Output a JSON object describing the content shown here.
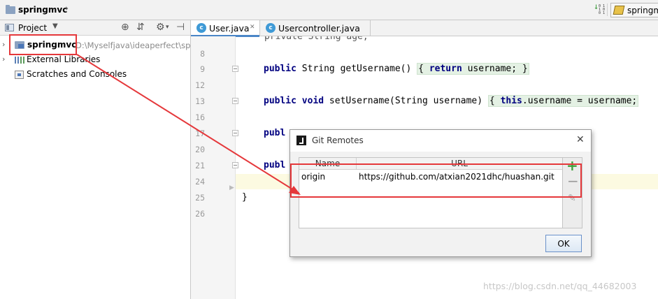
{
  "navbar": {
    "project_name": "springmvc",
    "run_config_label": "springm"
  },
  "project_panel": {
    "header_label": "Project",
    "tree": [
      {
        "name": "springmvc",
        "path": "D:\\Myselfjava\\ideaperfect\\sp"
      },
      {
        "name": "External Libraries"
      },
      {
        "name": "Scratches and Consoles"
      }
    ]
  },
  "editor": {
    "tabs": [
      {
        "label": "User.java",
        "active": true
      },
      {
        "label": "Usercontroller.java",
        "active": false
      }
    ],
    "line_numbers": [
      "8",
      "9",
      "12",
      "13",
      "16",
      "17",
      "20",
      "21",
      "24",
      "25",
      "26"
    ],
    "code": {
      "top_partial": "private String age;",
      "line9": {
        "a": "public",
        "b": " String getUsername() ",
        "c": "{ ",
        "d": "return",
        "e": " username; }"
      },
      "line13": {
        "a": "public",
        "b": " ",
        "c": "void",
        "d": " setUsername(String username) ",
        "e": "{ ",
        "f": "this",
        "g": ".username = username;"
      },
      "line17": "publ",
      "line21": "publ",
      "line25": "}"
    }
  },
  "dialog": {
    "title": "Git Remotes",
    "columns": {
      "name": "Name",
      "url": "URL"
    },
    "rows": [
      {
        "name": "origin",
        "url": "https://github.com/atxian2021dhc/huashan.git"
      }
    ],
    "ok_label": "OK"
  },
  "watermark": "https://blog.csdn.net/qq_44682003",
  "colors": {
    "annotation_red": "#e5383b",
    "keyword_navy": "#000080",
    "add_green": "#3ba13b",
    "tab_active_accent": "#4a86c7"
  }
}
